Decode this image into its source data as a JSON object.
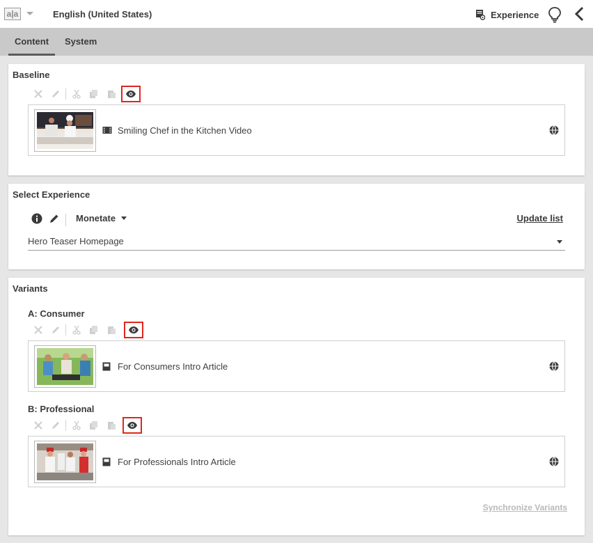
{
  "header": {
    "language": "English (United States)",
    "experience_label": "Experience"
  },
  "tabs": [
    {
      "label": "Content",
      "active": true
    },
    {
      "label": "System",
      "active": false
    }
  ],
  "baseline": {
    "title": "Baseline",
    "item": {
      "label": "Smiling Chef in the Kitchen Video",
      "type": "video"
    }
  },
  "select_experience": {
    "title": "Select Experience",
    "provider": "Monetate",
    "update_link": "Update list",
    "selected_experience": "Hero Teaser Homepage"
  },
  "variants": {
    "title": "Variants",
    "items": [
      {
        "title": "A: Consumer",
        "item_label": "For Consumers Intro Article",
        "type": "article"
      },
      {
        "title": "B: Professional",
        "item_label": "For Professionals Intro Article",
        "type": "article"
      }
    ],
    "sync_link": "Synchronize Variants"
  },
  "toolbar_icons": [
    "close-icon",
    "pencil-icon",
    "cut-icon",
    "copy-icon",
    "paste-icon",
    "eye-icon"
  ],
  "colors": {
    "highlight": "#e0261b",
    "tab_bar": "#c9c9c9",
    "background": "#e6e6e6"
  }
}
